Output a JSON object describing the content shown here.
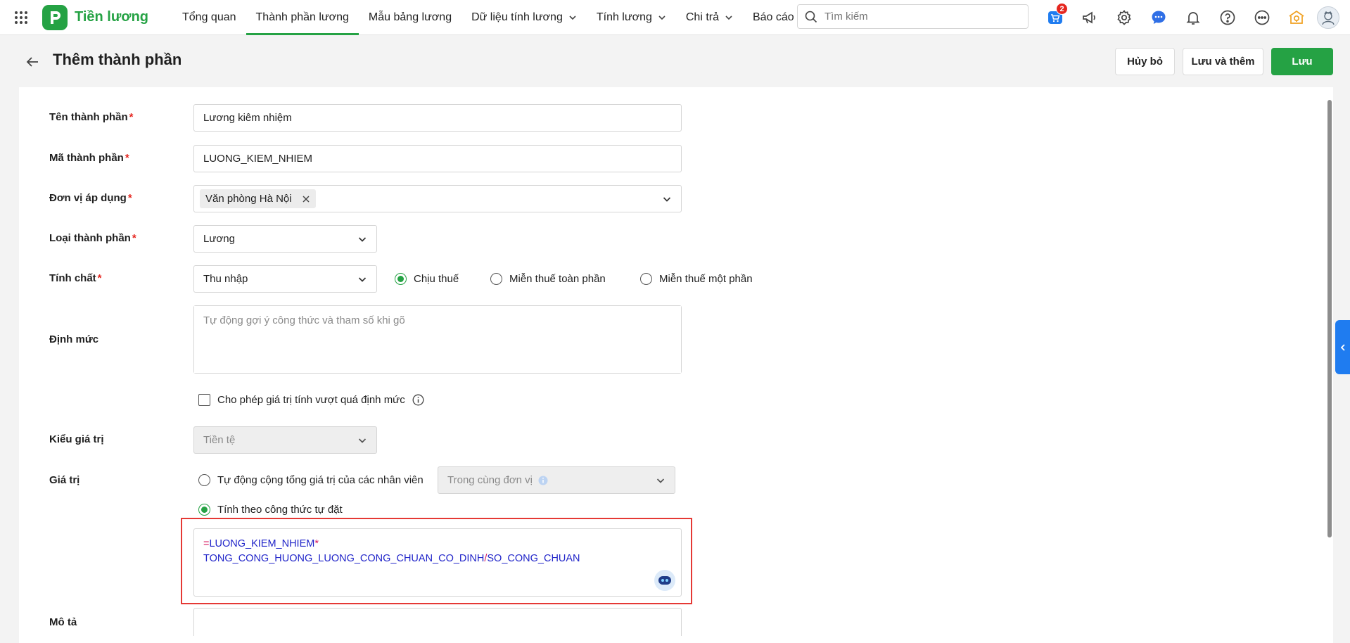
{
  "app": {
    "name": "Tiền lương",
    "brand_color": "#25a244"
  },
  "nav": {
    "items": [
      {
        "label": "Tổng quan",
        "active": false,
        "dropdown": false
      },
      {
        "label": "Thành phần lương",
        "active": true,
        "dropdown": false
      },
      {
        "label": "Mẫu bảng lương",
        "active": false,
        "dropdown": false
      },
      {
        "label": "Dữ liệu tính lương",
        "active": false,
        "dropdown": true
      },
      {
        "label": "Tính lương",
        "active": false,
        "dropdown": true
      },
      {
        "label": "Chi trả",
        "active": false,
        "dropdown": true
      },
      {
        "label": "Báo cáo",
        "active": false,
        "dropdown": false
      }
    ]
  },
  "search": {
    "placeholder": "Tìm kiếm"
  },
  "top_icons": {
    "cart_badge": "2",
    "icons": [
      "cart-icon",
      "megaphone-icon",
      "gear-icon",
      "chat-icon",
      "bell-icon",
      "help-icon",
      "more-icon",
      "lightbulb-icon",
      "avatar"
    ]
  },
  "header": {
    "title": "Thêm thành phần",
    "cancel_label": "Hủy bỏ",
    "save_add_label": "Lưu và thêm",
    "save_label": "Lưu"
  },
  "form": {
    "name": {
      "label": "Tên thành phần",
      "value": "Lương kiêm nhiệm"
    },
    "code": {
      "label": "Mã thành phần",
      "value": "LUONG_KIEM_NHIEM"
    },
    "unit": {
      "label": "Đơn vị áp dụng",
      "tag": "Văn phòng Hà Nội"
    },
    "type": {
      "label": "Loại thành phần",
      "value": "Lương"
    },
    "nature": {
      "label": "Tính chất",
      "value": "Thu nhập",
      "tax_options": [
        {
          "label": "Chịu thuế",
          "selected": true
        },
        {
          "label": "Miễn thuế toàn phần",
          "selected": false
        },
        {
          "label": "Miễn thuế một phần",
          "selected": false
        }
      ]
    },
    "quota": {
      "label": "Định mức",
      "placeholder": "Tự động gợi ý công thức và tham số khi gõ"
    },
    "allow_exceed": {
      "label": "Cho phép giá trị tính vượt quá định mức",
      "checked": false
    },
    "value_type": {
      "label": "Kiểu giá trị",
      "value": "Tiền tệ"
    },
    "value": {
      "label": "Giá trị",
      "auto_sum_label": "Tự động cộng tổng giá trị của các nhân viên",
      "auto_sum_selected": false,
      "scope_value": "Trong cùng đơn vị",
      "custom_formula_label": "Tính theo công thức tự đặt",
      "custom_formula_selected": true
    },
    "formula": {
      "eq": "=",
      "var1": "LUONG_KIEM_NHIEM",
      "op1": "*",
      "var2": "TONG_CONG_HUONG_LUONG_CONG_CHUAN_CO_DINH",
      "op2": "/",
      "var3": "SO_CONG_CHUAN"
    },
    "description": {
      "label": "Mô tả"
    }
  }
}
